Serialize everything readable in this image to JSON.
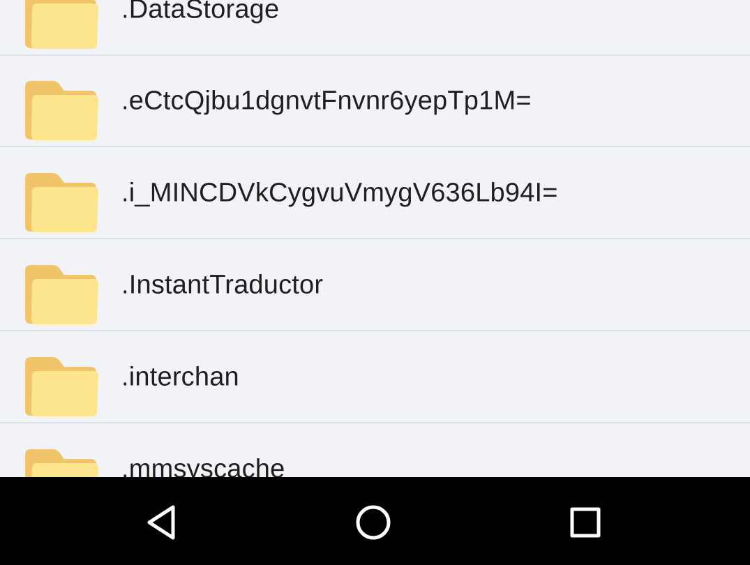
{
  "file_list": {
    "items": [
      {
        "name": ".DataStorage",
        "icon": "folder-icon"
      },
      {
        "name": ".eCtcQjbu1dgnvtFnvnr6yepTp1M=",
        "icon": "folder-icon"
      },
      {
        "name": ".i_MINCDVkCygvuVmygV636Lb94I=",
        "icon": "folder-icon"
      },
      {
        "name": ".InstantTraductor",
        "icon": "folder-icon"
      },
      {
        "name": ".interchan",
        "icon": "folder-icon"
      },
      {
        "name": ".mmsyscache",
        "icon": "folder-icon"
      }
    ]
  },
  "nav_bar": {
    "back_icon": "triangle-back-icon",
    "home_icon": "circle-home-icon",
    "recents_icon": "square-recents-icon"
  },
  "colors": {
    "row_background": "#f1f3f7",
    "divider": "#dfe2e7",
    "folder_back": "#f2c46a",
    "folder_front": "#fde58e",
    "nav_background": "#000000",
    "nav_icon": "#ffffff"
  }
}
